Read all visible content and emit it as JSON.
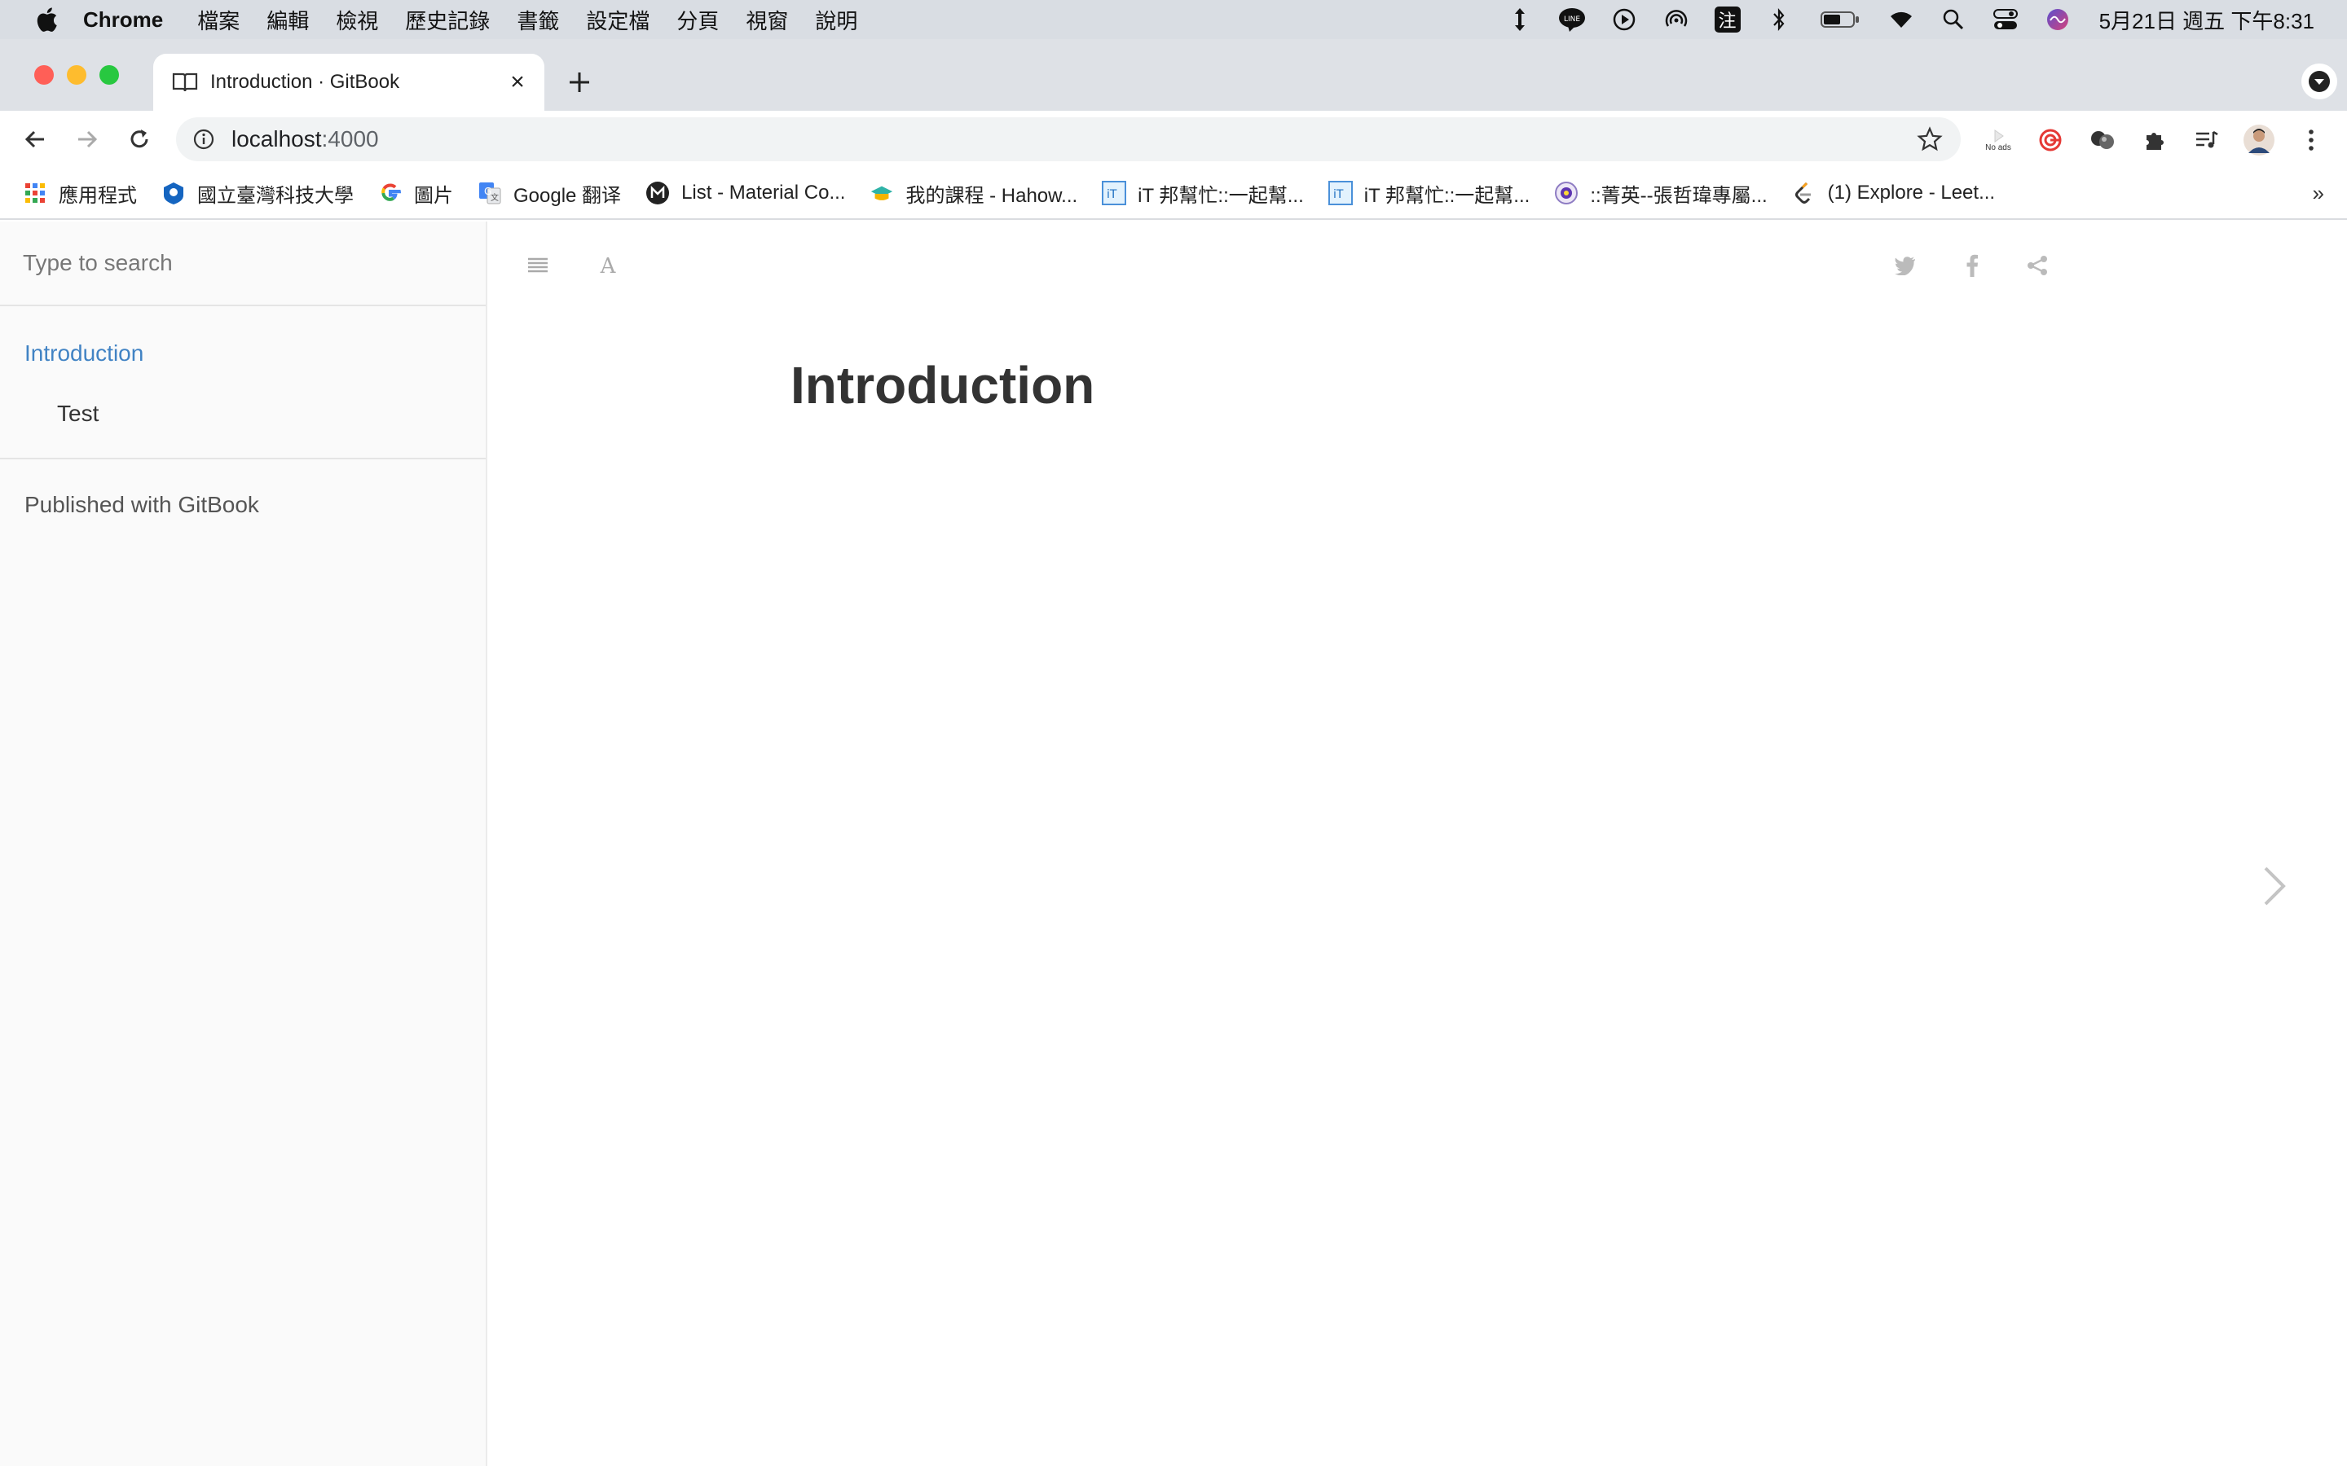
{
  "menubar": {
    "app_name": "Chrome",
    "items": [
      "檔案",
      "編輯",
      "檢視",
      "歷史記錄",
      "書籤",
      "設定檔",
      "分頁",
      "視窗",
      "說明"
    ],
    "clock": "5月21日 週五 下午8:31",
    "status_icons": [
      "updown-arrow-icon",
      "line-icon",
      "play-icon",
      "airdrop-icon",
      "input-method-icon",
      "bluetooth-icon",
      "battery-icon",
      "wifi-icon",
      "spotlight-icon",
      "control-center-icon",
      "siri-icon"
    ],
    "input_method_label": "注"
  },
  "browser": {
    "tab_title": "Introduction · GitBook",
    "url_host": "localhost",
    "url_port": ":4000",
    "bookmarks": [
      {
        "label": "應用程式",
        "icon": "apps-grid-icon"
      },
      {
        "label": "國立臺灣科技大學",
        "icon": "ntust-icon"
      },
      {
        "label": "圖片",
        "icon": "google-icon"
      },
      {
        "label": "Google 翻译",
        "icon": "google-translate-icon"
      },
      {
        "label": "List - Material Co...",
        "icon": "material-icon"
      },
      {
        "label": "我的課程 - Hahow...",
        "icon": "hahow-icon"
      },
      {
        "label": "iT 邦幫忙::一起幫...",
        "icon": "ithome-icon"
      },
      {
        "label": "iT 邦幫忙::一起幫...",
        "icon": "ithome-icon"
      },
      {
        "label": "::菁英--張哲瑋專屬...",
        "icon": "elite-icon"
      },
      {
        "label": "(1) Explore - Leet...",
        "icon": "leetcode-icon"
      }
    ],
    "ext_noads_label": "No ads"
  },
  "gitbook": {
    "search_placeholder": "Type to search",
    "nav": {
      "intro": "Introduction",
      "test": "Test"
    },
    "published": "Published with GitBook",
    "page_title": "Introduction",
    "colors": {
      "active_link": "#4183c4",
      "sidebar_bg": "#fafafa"
    }
  }
}
